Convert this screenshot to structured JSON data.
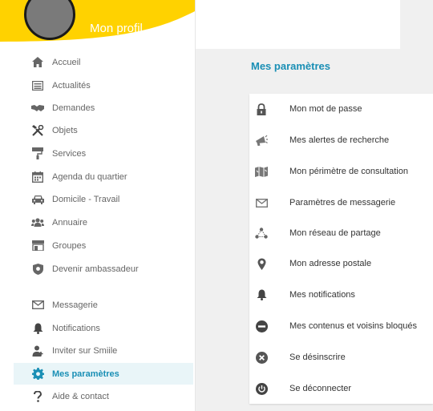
{
  "colors": {
    "accent": "#1a8fb5",
    "banner": "#ffd200",
    "icon": "#666666"
  },
  "profile": {
    "name": "Mon profil"
  },
  "sidebar": {
    "items": [
      {
        "label": "Accueil",
        "icon": "home-icon"
      },
      {
        "label": "Actualités",
        "icon": "newspaper-icon"
      },
      {
        "label": "Demandes",
        "icon": "handshake-icon"
      },
      {
        "label": "Objets",
        "icon": "tools-icon"
      },
      {
        "label": "Services",
        "icon": "paint-roller-icon"
      },
      {
        "label": "Agenda du quartier",
        "icon": "calendar-icon"
      },
      {
        "label": "Domicile - Travail",
        "icon": "car-icon"
      },
      {
        "label": "Annuaire",
        "icon": "users-icon"
      },
      {
        "label": "Groupes",
        "icon": "store-icon"
      },
      {
        "label": "Devenir ambassadeur",
        "icon": "badge-icon"
      },
      {
        "label": "Messagerie",
        "icon": "envelope-icon"
      },
      {
        "label": "Notifications",
        "icon": "bell-icon"
      },
      {
        "label": "Inviter sur Smiile",
        "icon": "user-plus-icon"
      },
      {
        "label": "Mes paramètres",
        "icon": "gear-icon",
        "active": true
      },
      {
        "label": "Aide & contact",
        "icon": "question-icon"
      }
    ]
  },
  "main": {
    "title": "Mes paramètres",
    "settings": [
      {
        "label": "Mon mot de passe",
        "icon": "lock-icon"
      },
      {
        "label": "Mes alertes de recherche",
        "icon": "megaphone-icon"
      },
      {
        "label": "Mon périmètre de consultation",
        "icon": "map-icon"
      },
      {
        "label": "Paramètres de messagerie",
        "icon": "envelope-icon"
      },
      {
        "label": "Mon réseau de partage",
        "icon": "network-icon"
      },
      {
        "label": "Mon adresse postale",
        "icon": "map-marker-icon"
      },
      {
        "label": "Mes notifications",
        "icon": "bell-icon"
      },
      {
        "label": "Mes contenus et voisins bloqués",
        "icon": "blocked-icon"
      },
      {
        "label": "Se désinscrire",
        "icon": "close-circle-icon"
      },
      {
        "label": "Se déconnecter",
        "icon": "power-icon"
      }
    ]
  }
}
